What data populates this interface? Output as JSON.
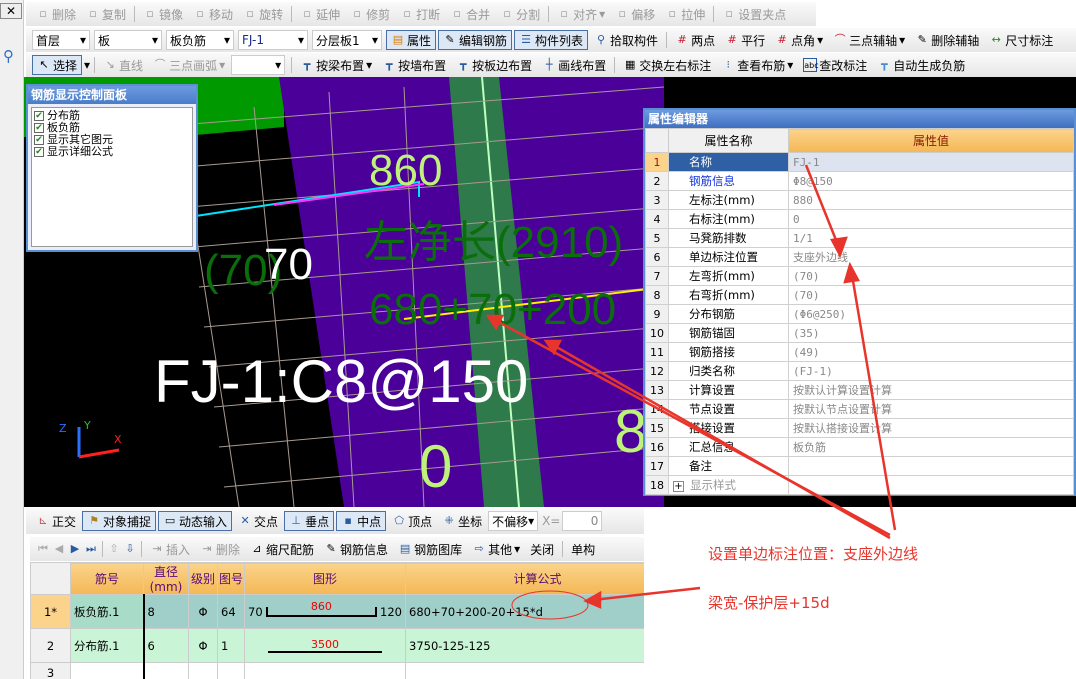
{
  "toolbar1": [
    "删除",
    "复制",
    "镜像",
    "移动",
    "旋转",
    "延伸",
    "修剪",
    "打断",
    "合并",
    "分割",
    "对齐",
    "偏移",
    "拉伸",
    "设置夹点"
  ],
  "selectors": [
    "首层",
    "板",
    "板负筋",
    "FJ-1",
    "分层板1"
  ],
  "toolbar2": {
    "attr": "属性",
    "edit_rebar": "编辑钢筋",
    "component_list": "构件列表",
    "pick": "拾取构件",
    "two_point": "两点",
    "parallel": "平行",
    "point_angle": "点角",
    "three_point_axis": "三点辅轴",
    "delete_axis": "删除辅轴",
    "dimension": "尺寸标注"
  },
  "toolbar3": {
    "select": "选择",
    "line": "直线",
    "arc": "三点画弧",
    "by_beam": "按梁布置",
    "by_wall": "按墙布置",
    "by_slab_edge": "按板边布置",
    "by_line": "画线布置",
    "swap_labels": "交换左右标注",
    "view_rebar": "查看布筋",
    "edit_label": "查改标注",
    "auto_neg": "自动生成负筋"
  },
  "control_panel": {
    "title": "钢筋显示控制面板",
    "items": [
      "分布筋",
      "板负筋",
      "显示其它图元",
      "显示详细公式"
    ]
  },
  "canvas": {
    "t860": "860",
    "t70a": "(70)",
    "t70b": "70",
    "left_len": "左净长(2910)",
    "formula": "680+70+200",
    "label": "FJ-1:C8@150",
    "t0": "0",
    "t8": "8",
    "axis_x": "X",
    "axis_y": "Y",
    "axis_z": "Z"
  },
  "property_editor": {
    "title": "属性编辑器",
    "col_name": "属性名称",
    "col_value": "属性值",
    "rows": [
      {
        "no": "1",
        "name": "名称",
        "value": "FJ-1"
      },
      {
        "no": "2",
        "name": "钢筋信息",
        "value": "Φ8@150"
      },
      {
        "no": "3",
        "name": "左标注(mm)",
        "value": "880"
      },
      {
        "no": "4",
        "name": "右标注(mm)",
        "value": "0"
      },
      {
        "no": "5",
        "name": "马凳筋排数",
        "value": "1/1"
      },
      {
        "no": "6",
        "name": "单边标注位置",
        "value": "支座外边线"
      },
      {
        "no": "7",
        "name": "左弯折(mm)",
        "value": "(70)"
      },
      {
        "no": "8",
        "name": "右弯折(mm)",
        "value": "(70)"
      },
      {
        "no": "9",
        "name": "分布钢筋",
        "value": "(Φ6@250)"
      },
      {
        "no": "10",
        "name": "钢筋锚固",
        "value": "(35)"
      },
      {
        "no": "11",
        "name": "钢筋搭接",
        "value": "(49)"
      },
      {
        "no": "12",
        "name": "归类名称",
        "value": "(FJ-1)"
      },
      {
        "no": "13",
        "name": "计算设置",
        "value": "按默认计算设置计算"
      },
      {
        "no": "14",
        "name": "节点设置",
        "value": "按默认节点设置计算"
      },
      {
        "no": "15",
        "name": "搭接设置",
        "value": "按默认搭接设置计算"
      },
      {
        "no": "16",
        "name": "汇总信息",
        "value": "板负筋"
      },
      {
        "no": "17",
        "name": "备注",
        "value": ""
      },
      {
        "no": "18",
        "name": "显示样式",
        "value": ""
      }
    ]
  },
  "snap_bar": {
    "ortho": "正交",
    "osnap": "对象捕捉",
    "dyn": "动态输入",
    "intersect": "交点",
    "perp": "垂点",
    "mid": "中点",
    "vertex": "顶点",
    "coord": "坐标",
    "offset": "不偏移",
    "x_label": "X=",
    "x_value": "0"
  },
  "grid_bar": {
    "insert": "插入",
    "delete": "删除",
    "scale": "缩尺配筋",
    "rebar_info": "钢筋信息",
    "rebar_lib": "钢筋图库",
    "other": "其他",
    "close": "关闭",
    "single": "单构"
  },
  "rebar_table": {
    "headers": [
      "筋号",
      "直径(mm)",
      "级别",
      "图号",
      "图形",
      "计算公式"
    ],
    "rows": [
      {
        "no": "1*",
        "name": "板负筋.1",
        "dia": "8",
        "grade": "Φ",
        "fig": "64",
        "left": "70",
        "len": "860",
        "right": "120",
        "formula": "680+70+200-20+15*d"
      },
      {
        "no": "2",
        "name": "分布筋.1",
        "dia": "6",
        "grade": "Φ",
        "fig": "1",
        "left": "",
        "len": "3500",
        "right": "",
        "formula": "3750-125-125"
      },
      {
        "no": "3",
        "name": "",
        "dia": "",
        "grade": "",
        "fig": "",
        "left": "",
        "len": "",
        "right": "",
        "formula": ""
      }
    ]
  },
  "annotations": {
    "a1": "设置单边标注位置：支座外边线",
    "a2": "梁宽-保护层+15d"
  },
  "colors": {
    "annotation": "#e8352c",
    "header": "#f4b755",
    "row_selected": "#9fcfc8",
    "row_normal": "#c9f5d6"
  }
}
